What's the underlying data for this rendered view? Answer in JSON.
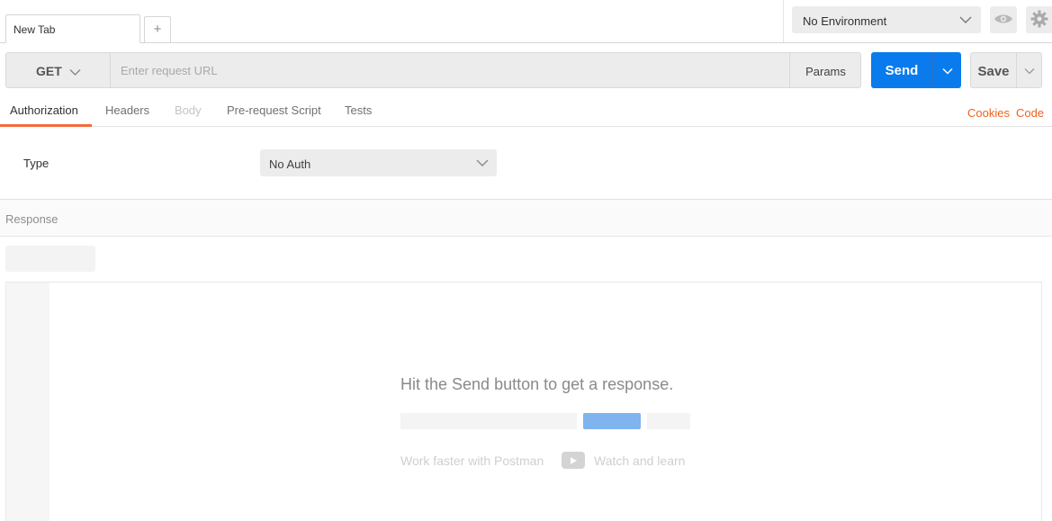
{
  "tabs": [
    {
      "label": "New Tab"
    }
  ],
  "tab_add_label": "+",
  "environment": {
    "selected": "No Environment"
  },
  "request": {
    "method": "GET",
    "url_placeholder": "Enter request URL",
    "url_value": "",
    "params_label": "Params",
    "send_label": "Send",
    "save_label": "Save"
  },
  "subtabs": [
    {
      "label": "Authorization",
      "state": "active"
    },
    {
      "label": "Headers",
      "state": "normal"
    },
    {
      "label": "Body",
      "state": "disabled"
    },
    {
      "label": "Pre-request Script",
      "state": "normal"
    },
    {
      "label": "Tests",
      "state": "normal"
    }
  ],
  "links": {
    "cookies": "Cookies",
    "code": "Code"
  },
  "auth": {
    "type_label": "Type",
    "type_value": "No Auth"
  },
  "response": {
    "header": "Response",
    "hint": "Hit the Send button to get a response.",
    "promo_text": "Work faster with Postman",
    "promo_link": "Watch and learn"
  },
  "colors": {
    "accent_blue": "#097bed",
    "accent_orange": "#f26b3a"
  }
}
